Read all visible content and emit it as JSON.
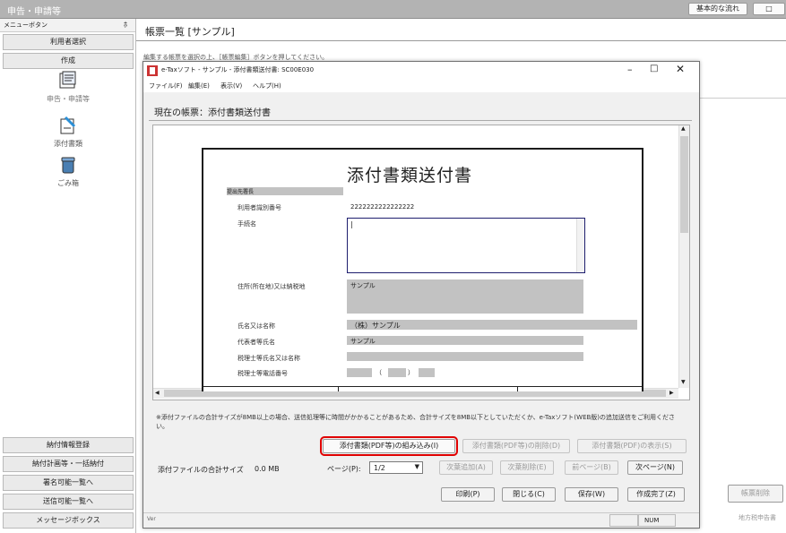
{
  "app": {
    "title": "申告・申請等",
    "top_buttons": [
      "基本的な流れ"
    ]
  },
  "sidebar": {
    "header": "メニューボタン",
    "pin": "ﾎ",
    "items": [
      "利用者選択",
      "作成"
    ],
    "icons": [
      {
        "label": "申告・申請等",
        "icon": "forms-icon"
      },
      {
        "label": "添付書類",
        "icon": "attachment-icon"
      },
      {
        "label": "ごみ箱",
        "icon": "trash-icon"
      }
    ],
    "bottom_items": [
      "納付情報登録",
      "納付計画等・一括納付",
      "署名可能一覧へ",
      "送信可能一覧へ",
      "メッセージボックス"
    ]
  },
  "main": {
    "title": "帳票一覧 [サンプル]",
    "hint": "編集する帳票を選択の上、［帳票編集］ボタンを押してください。",
    "right_buttons": [
      "帳票削除",
      "地方税申告書"
    ]
  },
  "dialog": {
    "title": "e-Taxソフト - サンプル - 添付書類送付書: SC00E030",
    "menu": [
      "ファイル(F)",
      "編集(E)",
      "表示(V)",
      "ヘルプ(H)"
    ],
    "current_form": "現在の帳票：添付書類送付書",
    "doc": {
      "title": "添付書類送付書",
      "section": "提出先署長",
      "fields": {
        "user_id_label": "利用者識別番号",
        "user_id": "2222222222222222",
        "procedure_label": "手続名",
        "procedure_value": "|",
        "address_label": "住所(所在地)又は納税地",
        "address": "サンプル",
        "name_label": "氏名又は名称",
        "name": "（株）サンプル",
        "rep_label": "代表者等氏名",
        "rep": "サンプル",
        "tax_acct_label": "税理士等氏名又は名称",
        "tax_phone_label": "税理士等電話番号",
        "phone_open": "（",
        "phone_close": "）"
      }
    },
    "note": "※添付ファイルの合計サイズが8MB以上の場合、送信処理等に時間がかかることがあるため、合計サイズを8MB以下としていただくか、e-Taxソフト(WEB版)の追加送信をご利用ください。",
    "buttons": {
      "attach": "添付書類(PDF等)の組み込み(I)",
      "delete_attach": "添付書類(PDF等)の削除(D)",
      "show_attach": "添付書類(PDF)の表示(S)",
      "size_label": "添付ファイルの合計サイズ",
      "size_value": "0.0 MB",
      "page_label": "ページ(P):",
      "page_value": "1/2",
      "next_add": "次葉追加(A)",
      "next_delete": "次葉削除(E)",
      "prev_page": "前ページ(B)",
      "next_page": "次ページ(N)",
      "print": "印刷(P)",
      "close": "閉じる(C)",
      "save": "保存(W)",
      "done": "作成完了(Z)"
    },
    "status": {
      "num": "NUM",
      "ver": "Ver"
    }
  },
  "colors": {
    "highlight": "#e00000",
    "title_bar": "#b5b5b5",
    "form_border": "#1b1b1b",
    "field_gray": "#c2c2c2"
  }
}
